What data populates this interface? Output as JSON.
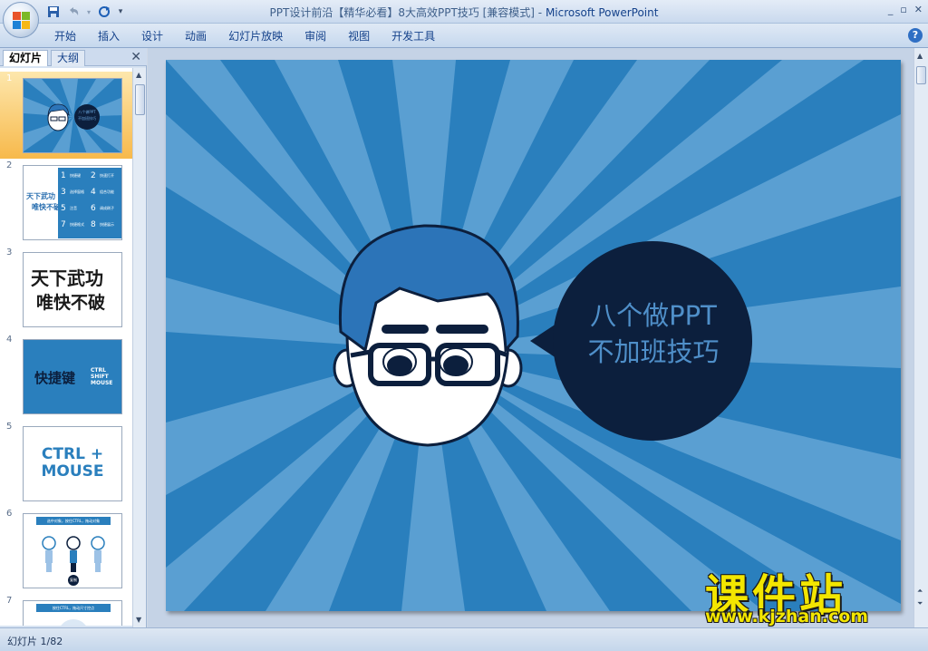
{
  "window": {
    "title": "PPT设计前沿【精华必看】8大高效PPT技巧 [兼容模式]",
    "app_name": "Microsoft PowerPoint",
    "separator": " - "
  },
  "ribbon": {
    "tabs": [
      "开始",
      "插入",
      "设计",
      "动画",
      "幻灯片放映",
      "审阅",
      "视图",
      "开发工具"
    ]
  },
  "left_pane": {
    "tabs": [
      "幻灯片",
      "大纲"
    ],
    "active_tab": "幻灯片",
    "selected_slide": 1,
    "thumbnails": [
      {
        "number": "1",
        "lines": [
          "八个做PPT",
          "不加班技巧"
        ]
      },
      {
        "number": "2",
        "title": [
          "天下武功",
          "唯快不破"
        ],
        "items": [
          "1",
          "快捷键",
          "2",
          "快速打开",
          "3",
          "选择窗格",
          "4",
          "组合功能",
          "5",
          "注音",
          "6",
          "调成刷子",
          "7",
          "快捷格式",
          "8",
          "快捷展示"
        ]
      },
      {
        "number": "3",
        "lines": [
          "天下武功",
          "唯快不破"
        ]
      },
      {
        "number": "4",
        "main": "快捷键",
        "side": [
          "CTRL",
          "SHIFT",
          "MOUSE"
        ]
      },
      {
        "number": "5",
        "lines": [
          "CTRL +",
          "MOUSE"
        ]
      },
      {
        "number": "6",
        "header": "选中对象，按住CTRL，拖动对象",
        "badge": "复制"
      },
      {
        "number": "7",
        "header": "按住CTRL，拖动尺寸控点"
      }
    ]
  },
  "slide": {
    "bubble_lines": [
      "八个做PPT",
      "不加班技巧"
    ],
    "colors": {
      "bg_dark": "#2a7fbd",
      "bg_light": "#5a9fd2",
      "bubble": "#0c1f3d",
      "bubble_text": "#4f8fc9",
      "hair": "#2c74b8"
    }
  },
  "watermark": {
    "title": "课件站",
    "url": "www.kjzhan.com"
  },
  "status": {
    "slide_label": "幻灯片 1/82"
  }
}
